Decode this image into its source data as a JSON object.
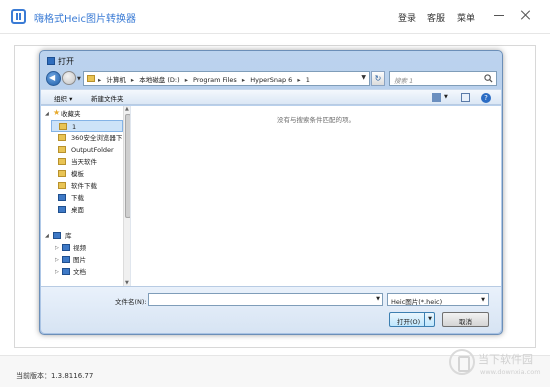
{
  "app": {
    "title": "嗨格式Heic图片转换器",
    "login": "登录",
    "service": "客服",
    "menu": "菜单"
  },
  "dialog": {
    "title": "打开",
    "address": [
      "计算机",
      "本地磁盘 (D:)",
      "Program Files",
      "HyperSnap 6",
      "1"
    ],
    "search_placeholder": "搜索 1",
    "toolbar": {
      "organize": "组织 ▾",
      "new_folder": "新建文件夹"
    },
    "nav": {
      "favorites": "收藏夹",
      "items": [
        "1",
        "360安全浏览器下",
        "OutputFolder",
        "当天软件",
        "模板",
        "软件下载",
        "下载",
        "桌面"
      ],
      "library": "库",
      "library_items": [
        "视频",
        "图片",
        "文档"
      ]
    },
    "empty_message": "没有与搜索条件匹配的项。",
    "filename_label": "文件名(N):",
    "filename_value": "",
    "filter_value": "Heic图片(*.heic)",
    "open_button": "打开(O)",
    "cancel_button": "取消"
  },
  "footer": {
    "version": "当前版本：1.3.8116.77"
  },
  "watermark": {
    "title": "当下软件园",
    "url": "www.downxia.com"
  },
  "icons": [
    "app-logo-icon",
    "back-arrow-icon",
    "forward-arrow-icon",
    "folder-icon",
    "refresh-icon",
    "search-icon",
    "star-icon",
    "view-icon",
    "preview-pane-icon",
    "help-icon",
    "library-icon",
    "video-icon",
    "image-icon",
    "document-icon",
    "download-icon",
    "desktop-icon"
  ],
  "colors": {
    "brand": "#3a7bd5",
    "dialog_frame": "#a9c3e4"
  }
}
